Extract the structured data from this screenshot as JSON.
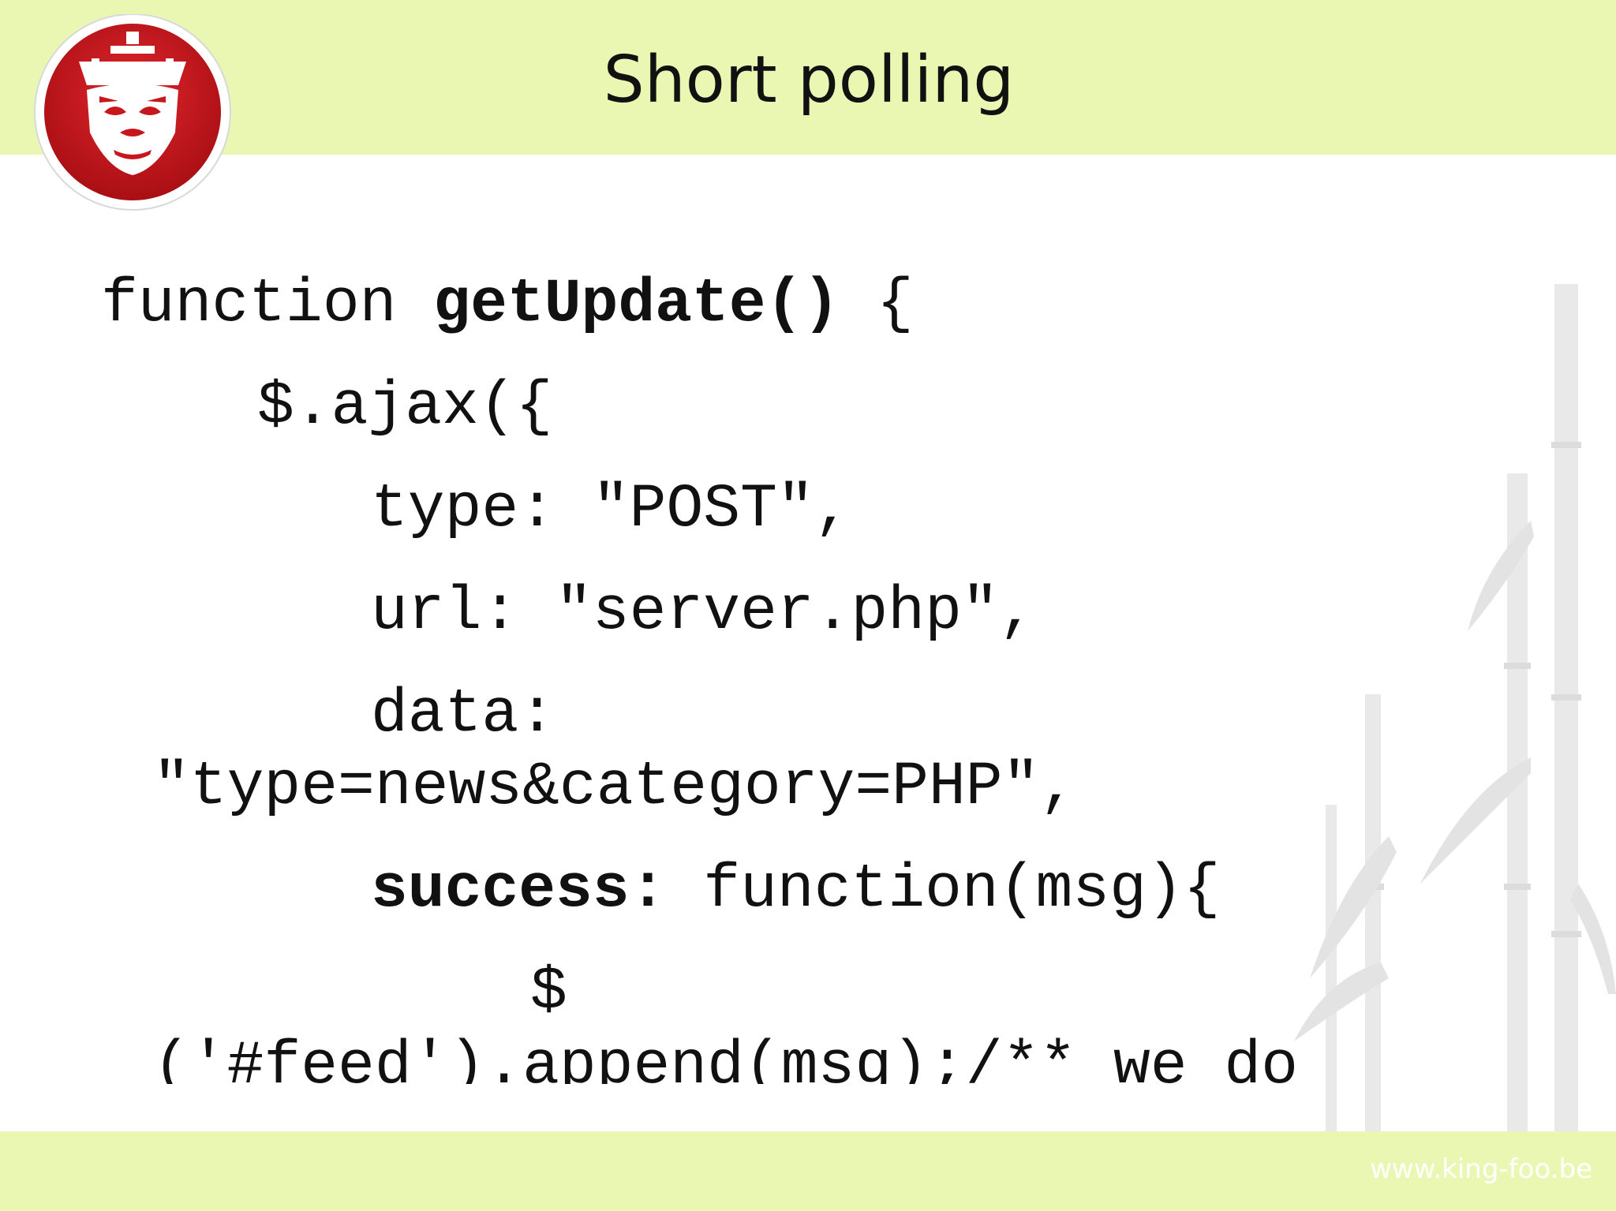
{
  "slide": {
    "title": "Short polling",
    "footer_url": "www.king-foo.be"
  },
  "colors": {
    "band": "#eaf7b2",
    "logo_red": "#c8161d",
    "text": "#111111"
  },
  "code": {
    "line1_kw": "function",
    "line1_fn": "getUpdate()",
    "line1_brace": "{",
    "line2": "$.ajax({",
    "line3": "type: \"POST\",",
    "line4": "url: \"server.php\",",
    "line5": "data:",
    "line6": "\"type=news&category=PHP\",",
    "line7_kw": "success:",
    "line7_rest": "function(msg){",
    "line8": "$",
    "line9": "('#feed').append(msg);/** we do"
  },
  "icons": {
    "logo": "monkey-king-logo-icon",
    "decor": "bamboo-decoration-icon"
  }
}
